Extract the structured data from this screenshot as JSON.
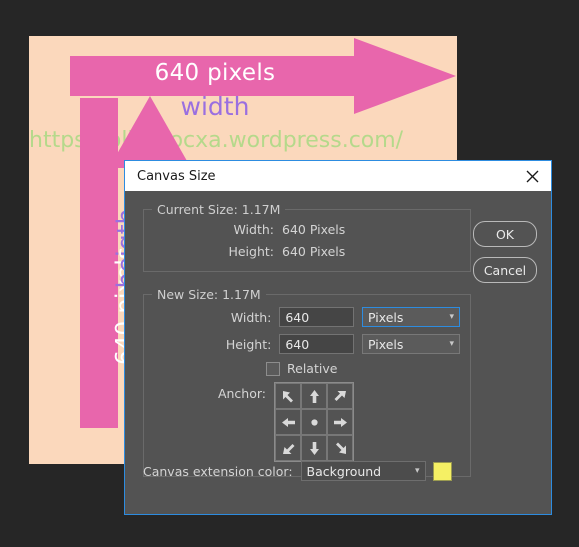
{
  "photo": {
    "h_arrow_text": "640 pixels",
    "width_label": "width",
    "watermark": "https://olinerocxa.wordpress.com/",
    "v_arrow_text": "640 pixels",
    "height_label": "heigth",
    "colors": {
      "canvas_bg": "#fbd8bc",
      "arrow_pink": "#e866ac",
      "label_purple": "#9a6fe0",
      "watermark_green": "#b5d98b"
    }
  },
  "dialog": {
    "title": "Canvas Size",
    "close_icon": "close-icon",
    "accent": "#2d8ce0",
    "current_size": {
      "title": "Current Size: 1.17M",
      "width_label": "Width:",
      "width_value": "640 Pixels",
      "height_label": "Height:",
      "height_value": "640 Pixels"
    },
    "new_size": {
      "title": "New Size: 1.17M",
      "width_label": "Width:",
      "width_value": "640",
      "width_unit": "Pixels",
      "height_label": "Height:",
      "height_value": "640",
      "height_unit": "Pixels",
      "relative_label": "Relative",
      "relative_checked": false,
      "anchor_label": "Anchor:",
      "anchor_cells": [
        "arrow-up-left-icon",
        "arrow-up-icon",
        "arrow-up-right-icon",
        "arrow-left-icon",
        "anchor-center-dot-icon",
        "arrow-right-icon",
        "arrow-down-left-icon",
        "arrow-down-icon",
        "arrow-down-right-icon"
      ]
    },
    "extension": {
      "label": "Canvas extension color:",
      "value": "Background",
      "swatch_color": "#f5f064"
    },
    "buttons": {
      "ok": "OK",
      "cancel": "Cancel"
    }
  }
}
